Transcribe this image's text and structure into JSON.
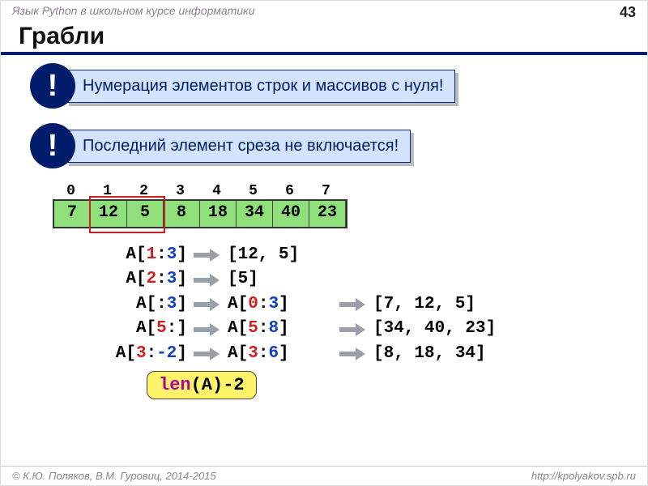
{
  "header": {
    "course": "Язык Python в школьном курсе информатики",
    "page": "43"
  },
  "title": "Грабли",
  "callouts": [
    {
      "bang": "!",
      "text": "Нумерация элементов строк и массивов с нуля!"
    },
    {
      "bang": "!",
      "text": "Последний элемент среза не включается!"
    }
  ],
  "indices": [
    "0",
    "1",
    "2",
    "3",
    "4",
    "5",
    "6",
    "7"
  ],
  "array": [
    "7",
    "12",
    "5",
    "8",
    "18",
    "34",
    "40",
    "23"
  ],
  "examples": [
    {
      "lhs_pre": "A[",
      "lhs_a": "1",
      "lhs_sep": ":",
      "lhs_b": "3",
      "lhs_post": "]",
      "mid": "",
      "rhs": "[12, 5]"
    },
    {
      "lhs_pre": "A[",
      "lhs_a": "2",
      "lhs_sep": ":",
      "lhs_b": "3",
      "lhs_post": "]",
      "mid": "",
      "rhs": "[5]"
    },
    {
      "lhs_pre": "A[:",
      "lhs_a": "",
      "lhs_sep": "",
      "lhs_b": "3",
      "lhs_post": "]",
      "mid_pre": "A[",
      "mid_a": "0",
      "mid_sep": ":",
      "mid_b": "3",
      "mid_post": "]",
      "rhs": "[7, 12, 5]"
    },
    {
      "lhs_pre": "A[",
      "lhs_a": "5",
      "lhs_sep": ":",
      "lhs_b": "",
      "lhs_post": "]",
      "mid_pre": "A[",
      "mid_a": "5",
      "mid_sep": ":",
      "mid_b": "8",
      "mid_post": "]",
      "rhs": "[34, 40, 23]"
    },
    {
      "lhs_pre": "A[",
      "lhs_a": "3",
      "lhs_sep": ":",
      "lhs_b": "-2",
      "lhs_post": "]",
      "mid_pre": "A[",
      "mid_a": "3",
      "mid_sep": ":",
      "mid_b": "6",
      "mid_post": "]",
      "rhs": "[8, 18, 34]"
    }
  ],
  "len_expr": {
    "fn": "len",
    "arg": "(A)-2"
  },
  "footer": {
    "left": "© К.Ю. Поляков, В.М. Гуровиц, 2014-2015",
    "right": "http://kpolyakov.spb.ru"
  }
}
